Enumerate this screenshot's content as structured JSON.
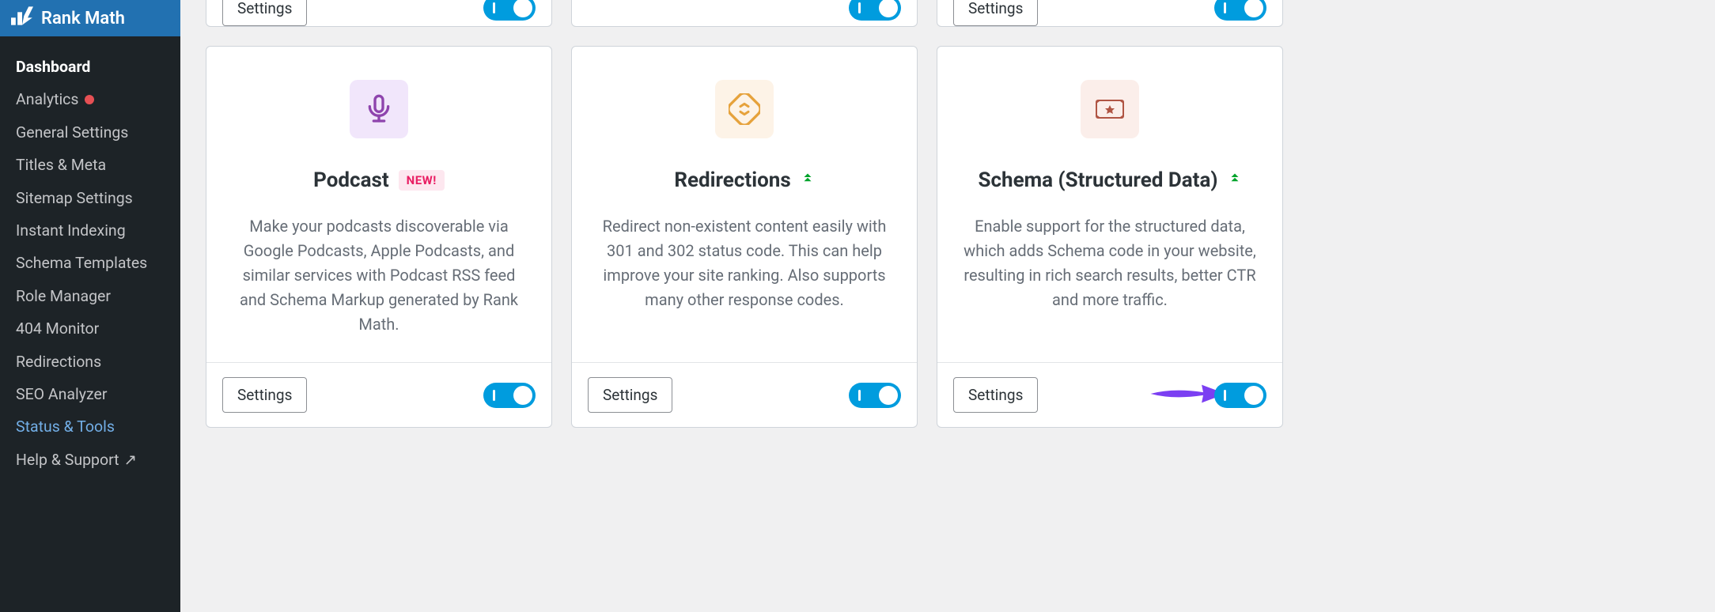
{
  "sidebar": {
    "brand": "Rank Math",
    "items": [
      {
        "label": "Dashboard",
        "style": "bold"
      },
      {
        "label": "Analytics",
        "dot": true
      },
      {
        "label": "General Settings"
      },
      {
        "label": "Titles & Meta"
      },
      {
        "label": "Sitemap Settings"
      },
      {
        "label": "Instant Indexing"
      },
      {
        "label": "Schema Templates"
      },
      {
        "label": "Role Manager"
      },
      {
        "label": "404 Monitor"
      },
      {
        "label": "Redirections"
      },
      {
        "label": "SEO Analyzer"
      },
      {
        "label": "Status & Tools",
        "style": "active"
      },
      {
        "label": "Help & Support",
        "ext": true
      }
    ]
  },
  "top_row": {
    "left": {
      "settings": "Settings"
    },
    "right": {
      "settings": "Settings"
    }
  },
  "cards": [
    {
      "id": "podcast",
      "title": "Podcast",
      "new_badge": "NEW!",
      "desc": "Make your podcasts discoverable via Google Podcasts, Apple Podcasts, and similar services with Podcast RSS feed and Schema Markup generated by Rank Math.",
      "settings": "Settings",
      "icon_color": "purple"
    },
    {
      "id": "redirections",
      "title": "Redirections",
      "pro": true,
      "desc": "Redirect non-existent content easily with 301 and 302 status code. This can help improve your site ranking. Also supports many other response codes.",
      "settings": "Settings",
      "icon_color": "orange"
    },
    {
      "id": "schema",
      "title": "Schema (Structured Data)",
      "pro": true,
      "desc": "Enable support for the structured data, which adds Schema code in your website, resulting in rich search results, better CTR and more traffic.",
      "settings": "Settings",
      "icon_color": "red",
      "highlight_arrow": true
    }
  ]
}
